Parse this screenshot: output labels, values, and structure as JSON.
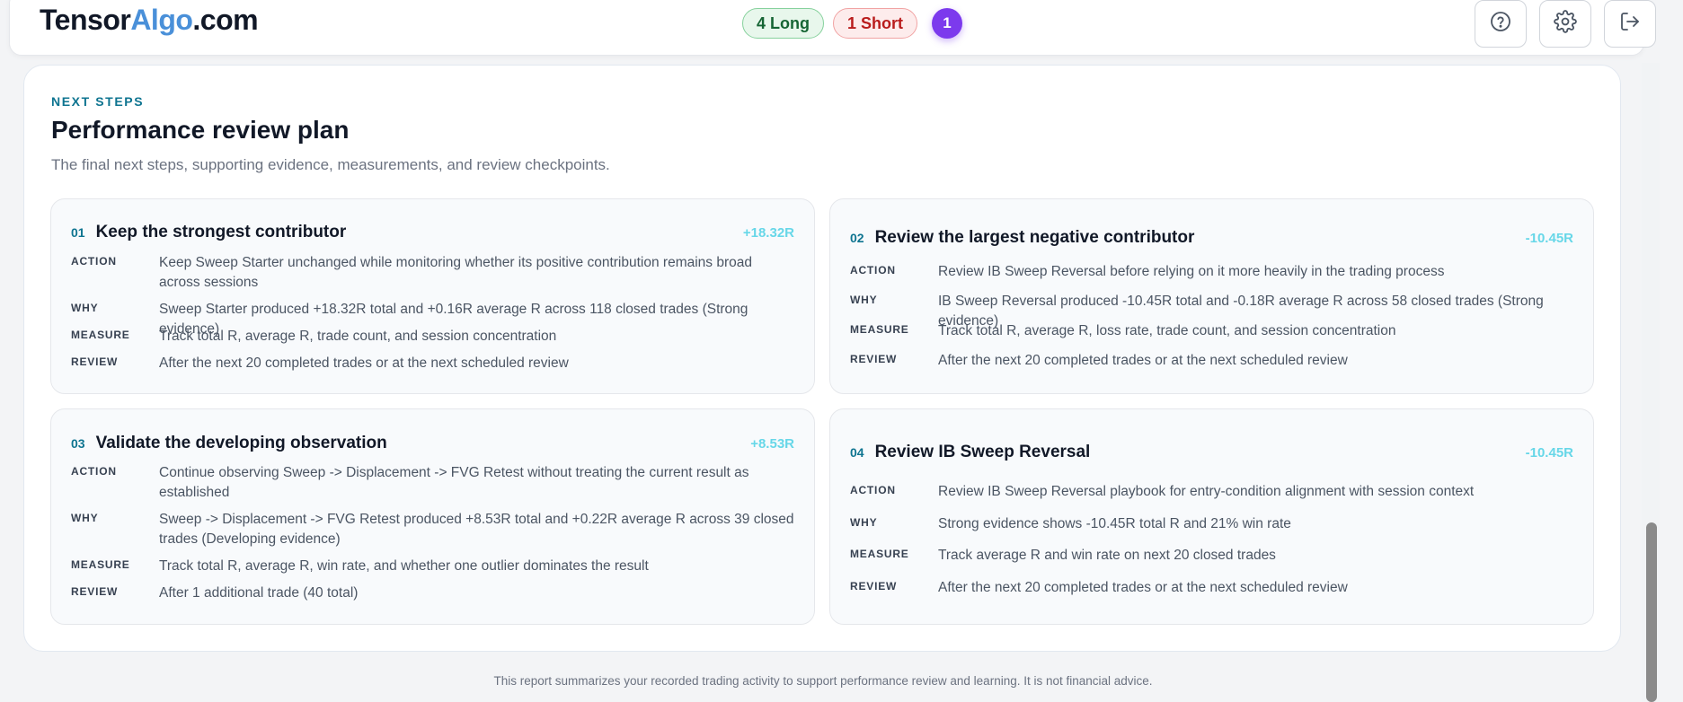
{
  "header": {
    "logo_part1": "Tensor",
    "logo_part2": "Algo",
    "logo_part3": ".com",
    "long_badge": "4 Long",
    "short_badge": "1 Short",
    "count_badge": "1",
    "icons": [
      "help-icon",
      "gear-icon",
      "logout-icon"
    ]
  },
  "section": {
    "eyebrow": "NEXT STEPS",
    "title": "Performance review plan",
    "subtitle": "The final next steps, supporting evidence, measurements, and review checkpoints."
  },
  "labels": {
    "action": "ACTION",
    "why": "WHY",
    "measure": "MEASURE",
    "review": "REVIEW"
  },
  "cards": [
    {
      "num": "01",
      "title": "Keep the strongest contributor",
      "delta": "+18.32R",
      "action": "Keep Sweep Starter unchanged while monitoring whether its positive contribution remains broad across sessions",
      "why": "Sweep Starter produced +18.32R total and +0.16R average R across 118 closed trades (Strong evidence)",
      "measure": "Track total R, average R, trade count, and session concentration",
      "review": "After the next 20 completed trades or at the next scheduled review"
    },
    {
      "num": "02",
      "title": "Review the largest negative contributor",
      "delta": "-10.45R",
      "action": "Review IB Sweep Reversal before relying on it more heavily in the trading process",
      "why": "IB Sweep Reversal produced -10.45R total and -0.18R average R across 58 closed trades (Strong evidence)",
      "measure": "Track total R, average R, loss rate, trade count, and session concentration",
      "review": "After the next 20 completed trades or at the next scheduled review"
    },
    {
      "num": "03",
      "title": "Validate the developing observation",
      "delta": "+8.53R",
      "action": "Continue observing Sweep -> Displacement -> FVG Retest without treating the current result as established",
      "why": "Sweep -> Displacement -> FVG Retest produced +8.53R total and +0.22R average R across 39 closed trades (Developing evidence)",
      "measure": "Track total R, average R, win rate, and whether one outlier dominates the result",
      "review": "After 1 additional trade (40 total)"
    },
    {
      "num": "04",
      "title": "Review IB Sweep Reversal",
      "delta": "-10.45R",
      "action": "Review IB Sweep Reversal playbook for entry-condition alignment with session context",
      "why": "Strong evidence shows -10.45R total R and 21% win rate",
      "measure": "Track average R and win rate on next 20 closed trades",
      "review": "After the next 20 completed trades or at the next scheduled review"
    }
  ],
  "footer": {
    "disclaimer": "This report summarizes your recorded trading activity to support performance review and learning. It is not financial advice."
  }
}
